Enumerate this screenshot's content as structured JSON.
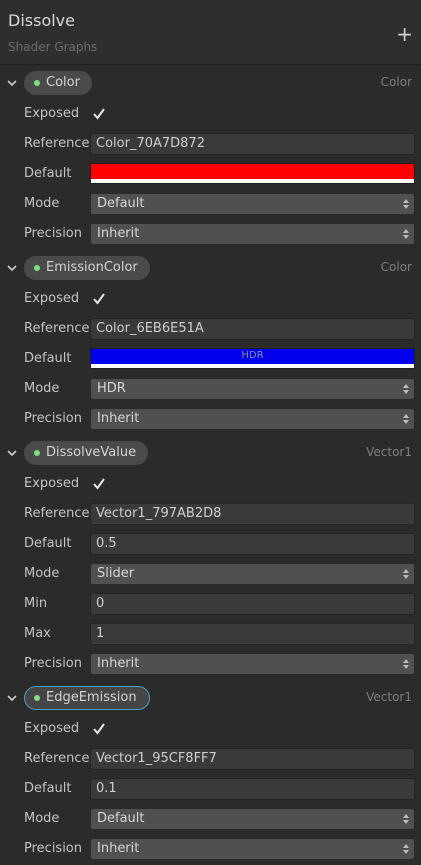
{
  "header": {
    "title": "Dissolve",
    "subtitle": "Shader Graphs",
    "add_icon": "plus-icon"
  },
  "labels": {
    "exposed": "Exposed",
    "reference": "Reference",
    "default": "Default",
    "mode": "Mode",
    "precision": "Precision",
    "min": "Min",
    "max": "Max"
  },
  "properties": [
    {
      "name": "Color",
      "type": "Color",
      "exposed": true,
      "reference": "Color_70A7D872",
      "default_color": "#ff0000",
      "mode": "Default",
      "precision": "Inherit"
    },
    {
      "name": "EmissionColor",
      "type": "Color",
      "exposed": true,
      "reference": "Color_6EB6E51A",
      "default_color": "#0000ee",
      "hdr_label": "HDR",
      "mode": "HDR",
      "precision": "Inherit"
    },
    {
      "name": "DissolveValue",
      "type": "Vector1",
      "exposed": true,
      "reference": "Vector1_797AB2D8",
      "default": "0.5",
      "mode": "Slider",
      "min": "0",
      "max": "1",
      "precision": "Inherit"
    },
    {
      "name": "EdgeEmission",
      "type": "Vector1",
      "exposed": true,
      "reference": "Vector1_95CF8FF7",
      "default": "0.1",
      "mode": "Default",
      "precision": "Inherit",
      "selected": true
    }
  ],
  "colors": {
    "accent_selected": "#47a0c9",
    "dot": "#7fe07f",
    "background": "#2b2b2b"
  }
}
